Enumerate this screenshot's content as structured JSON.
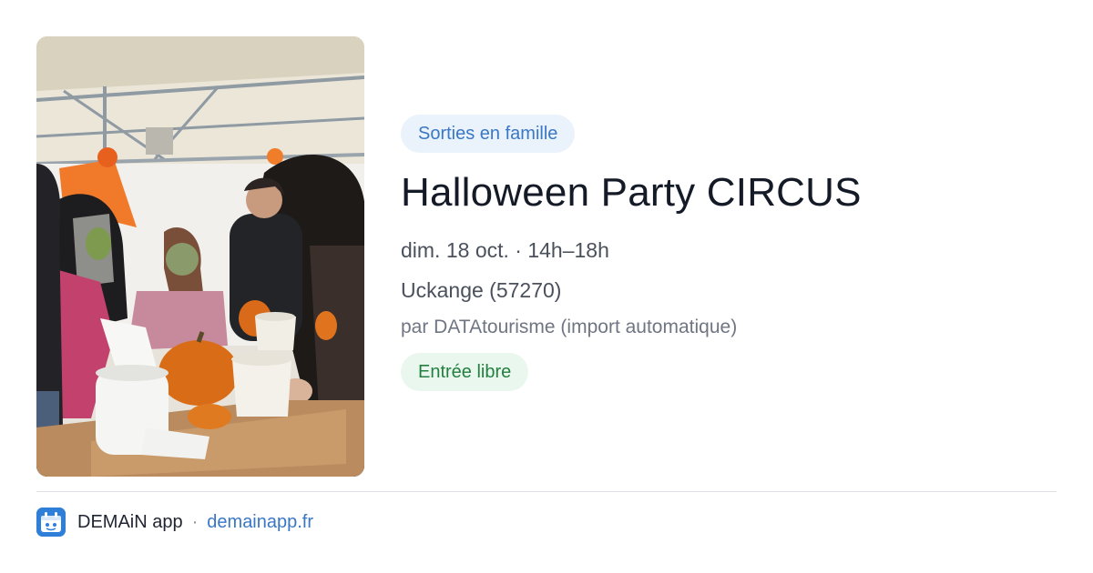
{
  "event": {
    "category": "Sorties en famille",
    "title": "Halloween Party CIRCUS",
    "when": "dim. 18 oct. · 14h–18h",
    "where": "Uckange (57270)",
    "source": "par DATAtourisme (import automatique)",
    "price": "Entrée libre",
    "image": "halloween-pumpkin-carving-photo"
  },
  "footer": {
    "app_name": "DEMAiN app",
    "separator": "·",
    "url": "demainapp.fr",
    "logo_icon": "demain-app-logo-icon"
  },
  "colors": {
    "accent_blue": "#3a77c4",
    "category_bg": "#eaf2fc",
    "price_green": "#23803f",
    "price_bg": "#eaf7ee"
  }
}
